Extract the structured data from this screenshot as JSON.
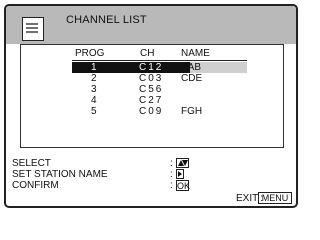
{
  "header": {
    "title": "CHANNEL LIST",
    "icon": "channel-list-icon"
  },
  "table": {
    "columns": [
      "PROG",
      "CH",
      "NAME"
    ],
    "rows": [
      {
        "prog": "1",
        "ch": "C12",
        "name": "AAB",
        "selected": true
      },
      {
        "prog": "2",
        "ch": "C03",
        "name": "CDE"
      },
      {
        "prog": "3",
        "ch": "C56",
        "name": ""
      },
      {
        "prog": "4",
        "ch": "C27",
        "name": ""
      },
      {
        "prog": "5",
        "ch": "C09",
        "name": "FGH"
      }
    ]
  },
  "footer": {
    "select_label": "SELECT",
    "set_station_label": "SET STATION NAME",
    "confirm_label": "CONFIRM",
    "colon": ":",
    "select_icon": "up-down-arrows-icon",
    "set_station_icon": "right-arrow-icon",
    "confirm_key": "OK",
    "exit_label": "EXIT",
    "exit_colon": ":",
    "menu_key": "MENU"
  }
}
